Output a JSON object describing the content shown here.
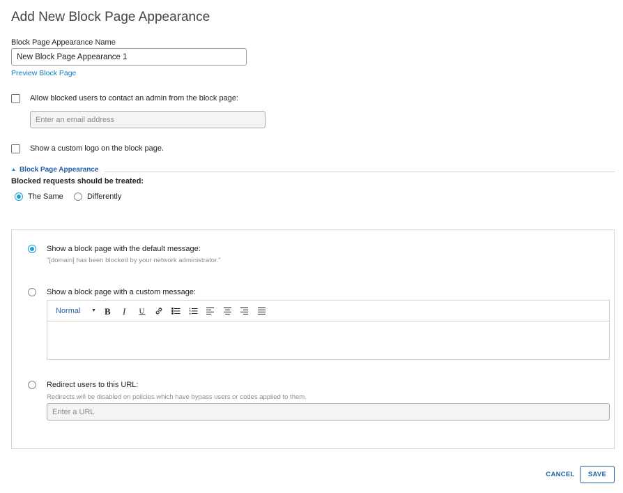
{
  "page": {
    "title": "Add New Block Page Appearance"
  },
  "name_field": {
    "label": "Block Page Appearance Name",
    "value": "New Block Page Appearance 1"
  },
  "preview_link": "Preview Block Page",
  "contact_admin": {
    "label": "Allow blocked users to contact an admin from the block page:",
    "checked": false,
    "email_placeholder": "Enter an email address"
  },
  "custom_logo": {
    "label": "Show a custom logo on the block page.",
    "checked": false
  },
  "section": {
    "title": "Block Page Appearance",
    "expanded": true
  },
  "treatment": {
    "label": "Blocked requests should be treated:",
    "options": [
      {
        "label": "The Same",
        "selected": true
      },
      {
        "label": "Differently",
        "selected": false
      }
    ]
  },
  "block_options": {
    "default_message": {
      "label": "Show a block page with the default message:",
      "helper": "\"[domain] has been blocked by your network administrator.\"",
      "selected": true
    },
    "custom_message": {
      "label": "Show a block page with a custom message:",
      "selected": false
    },
    "redirect": {
      "label": "Redirect users to this URL:",
      "helper": "Redirects will be disabled on policies which have bypass users or codes applied to them.",
      "url_placeholder": "Enter a URL",
      "selected": false
    }
  },
  "editor": {
    "format": "Normal",
    "tools": [
      "bold-icon",
      "italic-icon",
      "underline-icon",
      "link-icon",
      "bullet-list-icon",
      "numbered-list-icon",
      "align-left-icon",
      "align-center-icon",
      "align-right-icon",
      "align-justify-icon"
    ]
  },
  "footer": {
    "cancel_label": "CANCEL",
    "save_label": "SAVE"
  },
  "colors": {
    "accent": "#1aa0d8",
    "link": "#0d7cbf",
    "primary_text": "#1f5fa8"
  }
}
